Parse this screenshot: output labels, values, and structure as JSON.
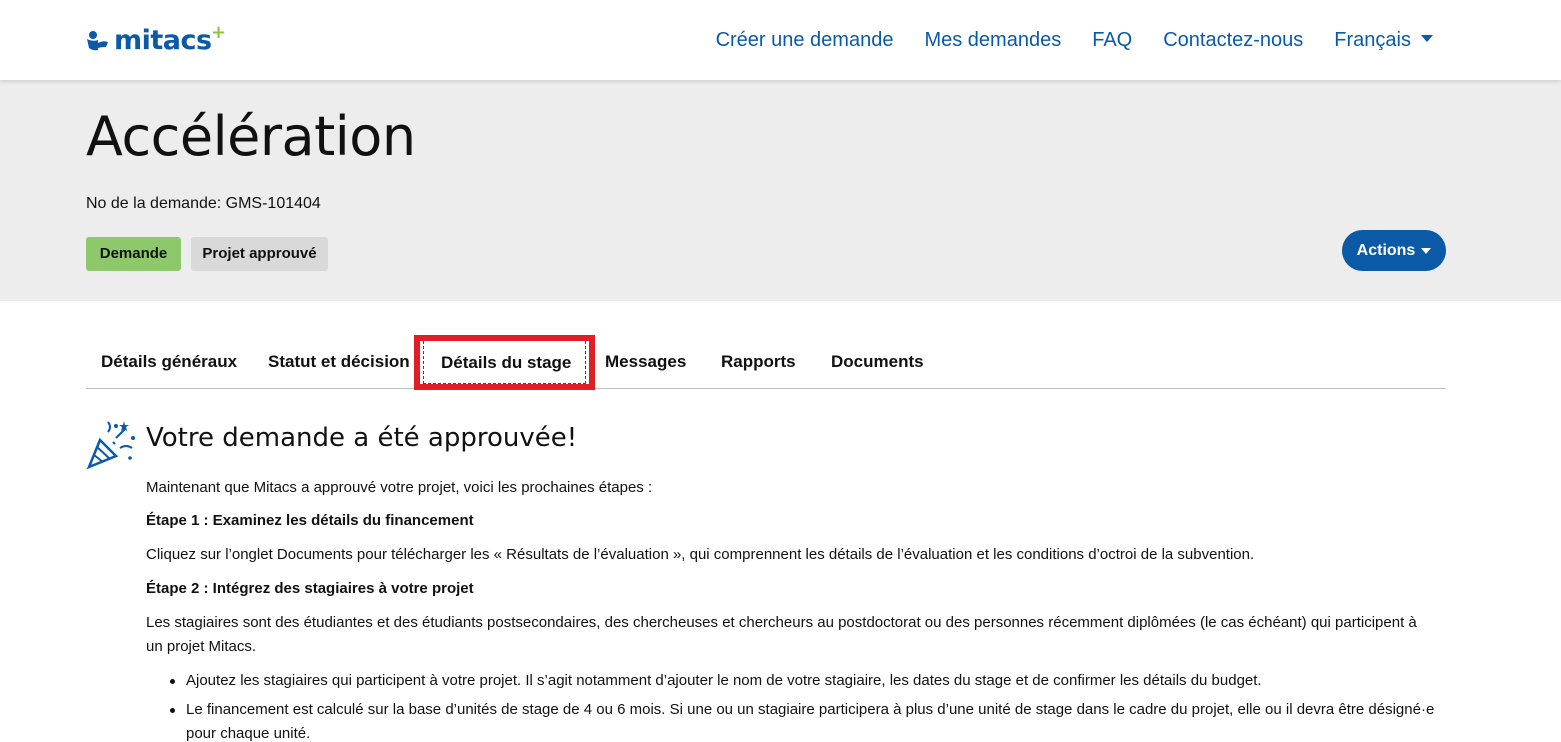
{
  "header": {
    "logo_text": "mitacs",
    "logo_plus": "+",
    "nav": [
      "Créer une demande",
      "Mes demandes",
      "FAQ",
      "Contactez-nous",
      "Français"
    ],
    "brand_color": "#0a5aa8"
  },
  "banner": {
    "title": "Accélération",
    "request_number": "No de la demande: GMS-101404",
    "badges": [
      "Demande",
      "Projet approuvé"
    ],
    "actions_label": "Actions"
  },
  "tabs": [
    "Détails généraux",
    "Statut et décision",
    "Détails du stage",
    "Messages",
    "Rapports",
    "Documents"
  ],
  "active_tab": "Détails du stage",
  "content": {
    "title": "Votre demande a été approuvée!",
    "intro": "Maintenant que Mitacs a approuvé votre projet, voici les prochaines étapes :",
    "step1_heading": "Étape 1 : Examinez les détails du financement",
    "step1_text": "Cliquez sur l’onglet Documents pour télécharger les « Résultats de l’évaluation », qui comprennent les détails de l’évaluation et les conditions d’octroi de la subvention.",
    "step2_heading": "Étape 2 : Intégrez des stagiaires à votre projet",
    "step2_text_line1": "Les stagiaires sont des étudiantes et des étudiants postsecondaires, des chercheuses et chercheurs au postdoctorat ou des personnes récemment diplômées (le cas échéant) qui participent à",
    "step2_text_line2": "un projet Mitacs.",
    "bullets": [
      "Ajoutez les stagiaires qui participent à votre projet. Il s’agit notamment d’ajouter le nom de votre stagiaire, les dates du stage et de confirmer les détails du budget.",
      "Le financement est calculé sur la base d’unités de stage de 4 ou 6 mois. Si une ou un stagiaire participera à plus d’une unité de stage dans le cadre du projet, elle ou il devra être désigné·e pour chaque unité."
    ]
  }
}
